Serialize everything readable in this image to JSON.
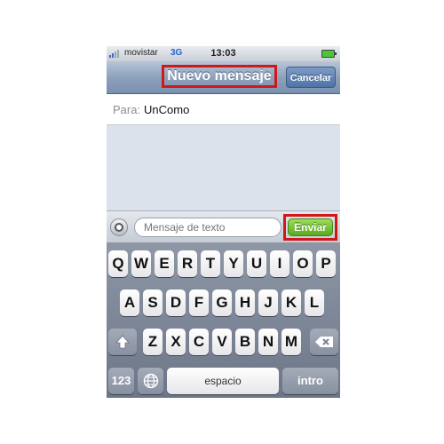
{
  "status_bar": {
    "carrier": "movistar",
    "network": "3G",
    "time": "13:03"
  },
  "nav": {
    "title": "Nuevo mensaje",
    "cancel_label": "Cancelar"
  },
  "recipient": {
    "label": "Para:",
    "value": "UnComo"
  },
  "compose": {
    "placeholder": "Mensaje de texto",
    "send_label": "Enviar"
  },
  "keyboard": {
    "row1": [
      "Q",
      "W",
      "E",
      "R",
      "T",
      "Y",
      "U",
      "I",
      "O",
      "P"
    ],
    "row2": [
      "A",
      "S",
      "D",
      "F",
      "G",
      "H",
      "J",
      "K",
      "L"
    ],
    "row3": [
      "Z",
      "X",
      "C",
      "V",
      "B",
      "N",
      "M"
    ],
    "numbers_label": "123",
    "space_label": "espacio",
    "return_label": "intro"
  },
  "highlight_color": "#d01818"
}
